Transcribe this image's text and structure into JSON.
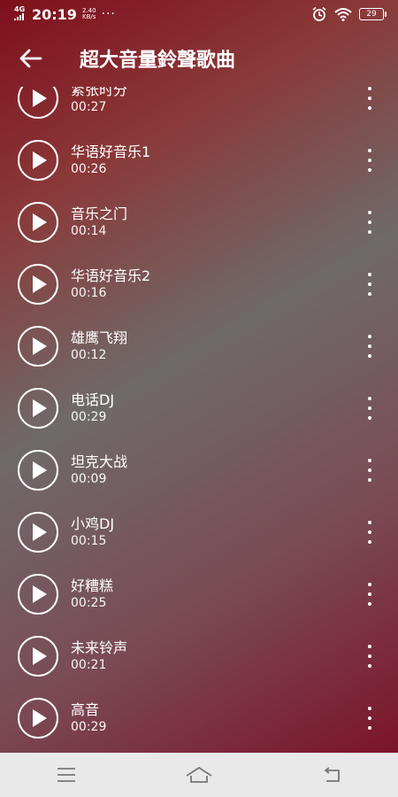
{
  "status_bar": {
    "network": "4G",
    "time": "20:19",
    "speed_value": "2.40",
    "speed_unit": "KB/s",
    "dots": "···",
    "battery": "29",
    "icons": [
      "alarm-icon",
      "wifi-icon",
      "battery-icon"
    ]
  },
  "toolbar": {
    "back_icon": "arrow-left-icon",
    "title": "超大音量鈴聲歌曲"
  },
  "songs": [
    {
      "title": "紧张时分",
      "duration": "00:27"
    },
    {
      "title": "华语好音乐1",
      "duration": "00:26"
    },
    {
      "title": "音乐之门",
      "duration": "00:14"
    },
    {
      "title": "华语好音乐2",
      "duration": "00:16"
    },
    {
      "title": "雄鹰飞翔",
      "duration": "00:12"
    },
    {
      "title": "电话DJ",
      "duration": "00:29"
    },
    {
      "title": "坦克大战",
      "duration": "00:09"
    },
    {
      "title": "小鸡DJ",
      "duration": "00:15"
    },
    {
      "title": "好糟糕",
      "duration": "00:25"
    },
    {
      "title": "未来铃声",
      "duration": "00:21"
    },
    {
      "title": "高音",
      "duration": "00:29"
    }
  ],
  "navbar": {
    "icons": [
      "menu-icon",
      "home-icon",
      "back-icon"
    ]
  },
  "colors": {
    "accent_red": "#7e0f1b",
    "navbar_bg": "#e9e9e9"
  }
}
